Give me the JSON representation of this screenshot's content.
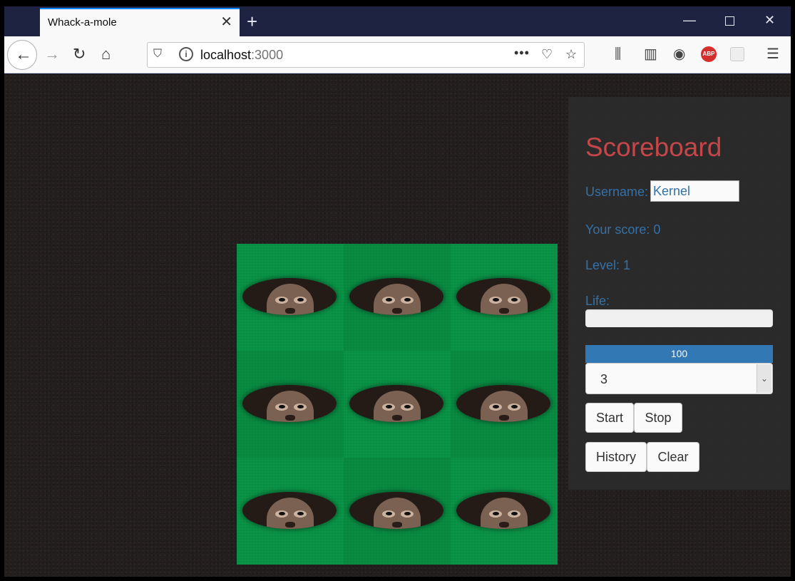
{
  "browser": {
    "tab_title": "Whack-a-mole",
    "url_host": "localhost",
    "url_port": ":3000"
  },
  "page": {
    "scoreboard": {
      "title": "Scoreboard",
      "username_label": "Username:",
      "username_value": "Kernel",
      "score_label": "Your score: 0",
      "level_label": "Level: 1",
      "life_label": "Life:",
      "progress_value": "100",
      "level_select_value": "3",
      "buttons": {
        "start": "Start",
        "stop": "Stop",
        "history": "History",
        "clear": "Clear"
      }
    },
    "board": {
      "rows": 3,
      "cols": 3,
      "cells": [
        "mole",
        "mole",
        "mole",
        "mole",
        "mole",
        "mole",
        "mole",
        "mole",
        "mole"
      ]
    }
  },
  "colors": {
    "title": "#c9474a",
    "label": "#3573a9",
    "progress": "#337ab7",
    "grass": "#0a9346"
  }
}
